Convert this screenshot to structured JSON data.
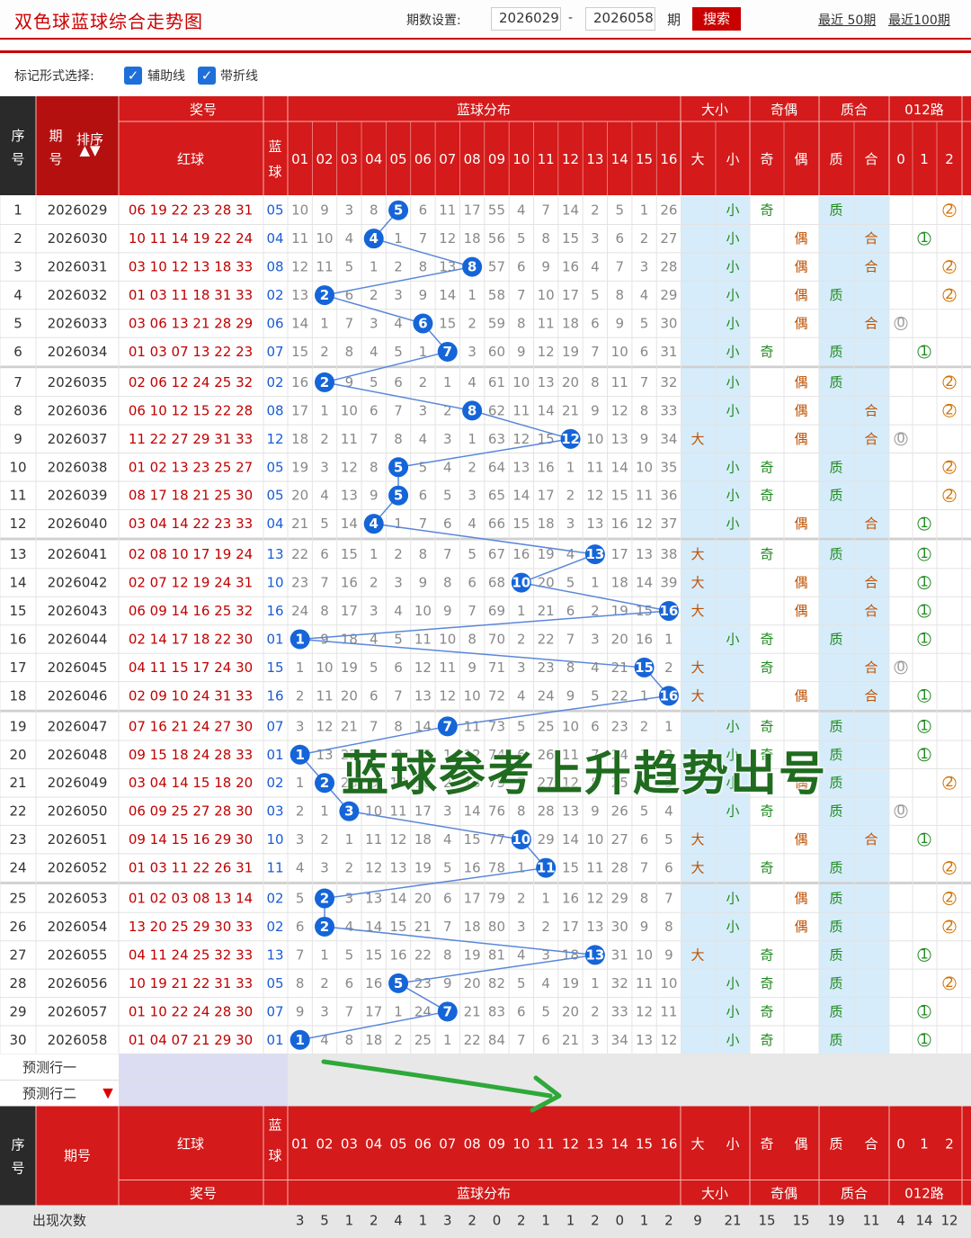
{
  "app": {
    "title": "双色球蓝球综合走势图"
  },
  "toolbar": {
    "issue_label": "期数设置:",
    "start_issue": "2026029",
    "dash": "-",
    "end_issue": "2026058",
    "unit": "期",
    "search_label": "搜索",
    "recent_50": "最近 50期",
    "recent_100": "最近100期"
  },
  "options": {
    "label": "标记形式选择:",
    "aux_line": {
      "label": "辅助线",
      "checked": true
    },
    "fold_line": {
      "label": "带折线",
      "checked": true
    }
  },
  "header": {
    "seq": "序号",
    "period": "期号",
    "sort": "排序",
    "award": "奖号",
    "red": "红球",
    "blue": "蓝球",
    "dist": "蓝球分布",
    "size": "大小",
    "big": "大",
    "small": "小",
    "parity": "奇偶",
    "odd": "奇",
    "even": "偶",
    "prime": "质合",
    "zhi": "质",
    "he": "合",
    "route": "012路",
    "r0": "0",
    "r1": "1",
    "r2": "2",
    "nums": [
      "01",
      "02",
      "03",
      "04",
      "05",
      "06",
      "07",
      "08",
      "09",
      "10",
      "11",
      "12",
      "13",
      "14",
      "15",
      "16"
    ]
  },
  "rows": [
    {
      "seq": "1",
      "period": "2026029",
      "red": "06 19 22 23 28 31",
      "blue": "05",
      "miss": [
        "10",
        "9",
        "3",
        "8",
        "5",
        "6",
        "11",
        "17",
        "55",
        "4",
        "7",
        "14",
        "2",
        "5",
        "1",
        "26"
      ],
      "size": "小",
      "parity": "奇",
      "prime": "质",
      "route": "2"
    },
    {
      "seq": "2",
      "period": "2026030",
      "red": "10 11 14 19 22 24",
      "blue": "04",
      "miss": [
        "11",
        "10",
        "4",
        "4",
        "1",
        "7",
        "12",
        "18",
        "56",
        "5",
        "8",
        "15",
        "3",
        "6",
        "2",
        "27"
      ],
      "size": "小",
      "parity": "偶",
      "prime": "合",
      "route": "1"
    },
    {
      "seq": "3",
      "period": "2026031",
      "red": "03 10 12 13 18 33",
      "blue": "08",
      "miss": [
        "12",
        "11",
        "5",
        "1",
        "2",
        "8",
        "13",
        "8",
        "57",
        "6",
        "9",
        "16",
        "4",
        "7",
        "3",
        "28"
      ],
      "size": "小",
      "parity": "偶",
      "prime": "合",
      "route": "2"
    },
    {
      "seq": "4",
      "period": "2026032",
      "red": "01 03 11 18 31 33",
      "blue": "02",
      "miss": [
        "13",
        "2",
        "6",
        "2",
        "3",
        "9",
        "14",
        "1",
        "58",
        "7",
        "10",
        "17",
        "5",
        "8",
        "4",
        "29"
      ],
      "size": "小",
      "parity": "偶",
      "prime": "质",
      "route": "2"
    },
    {
      "seq": "5",
      "period": "2026033",
      "red": "03 06 13 21 28 29",
      "blue": "06",
      "miss": [
        "14",
        "1",
        "7",
        "3",
        "4",
        "6",
        "15",
        "2",
        "59",
        "8",
        "11",
        "18",
        "6",
        "9",
        "5",
        "30"
      ],
      "size": "小",
      "parity": "偶",
      "prime": "合",
      "route": "0"
    },
    {
      "seq": "6",
      "period": "2026034",
      "red": "01 03 07 13 22 23",
      "blue": "07",
      "miss": [
        "15",
        "2",
        "8",
        "4",
        "5",
        "1",
        "7",
        "3",
        "60",
        "9",
        "12",
        "19",
        "7",
        "10",
        "6",
        "31"
      ],
      "size": "小",
      "parity": "奇",
      "prime": "质",
      "route": "1"
    },
    {
      "seq": "7",
      "period": "2026035",
      "red": "02 06 12 24 25 32",
      "blue": "02",
      "miss": [
        "16",
        "2",
        "9",
        "5",
        "6",
        "2",
        "1",
        "4",
        "61",
        "10",
        "13",
        "20",
        "8",
        "11",
        "7",
        "32"
      ],
      "size": "小",
      "parity": "偶",
      "prime": "质",
      "route": "2"
    },
    {
      "seq": "8",
      "period": "2026036",
      "red": "06 10 12 15 22 28",
      "blue": "08",
      "miss": [
        "17",
        "1",
        "10",
        "6",
        "7",
        "3",
        "2",
        "8",
        "62",
        "11",
        "14",
        "21",
        "9",
        "12",
        "8",
        "33"
      ],
      "size": "小",
      "parity": "偶",
      "prime": "合",
      "route": "2"
    },
    {
      "seq": "9",
      "period": "2026037",
      "red": "11 22 27 29 31 33",
      "blue": "12",
      "miss": [
        "18",
        "2",
        "11",
        "7",
        "8",
        "4",
        "3",
        "1",
        "63",
        "12",
        "15",
        "12",
        "10",
        "13",
        "9",
        "34"
      ],
      "size": "大",
      "parity": "偶",
      "prime": "合",
      "route": "0"
    },
    {
      "seq": "10",
      "period": "2026038",
      "red": "01 02 13 23 25 27",
      "blue": "05",
      "miss": [
        "19",
        "3",
        "12",
        "8",
        "5",
        "5",
        "4",
        "2",
        "64",
        "13",
        "16",
        "1",
        "11",
        "14",
        "10",
        "35"
      ],
      "size": "小",
      "parity": "奇",
      "prime": "质",
      "route": "2"
    },
    {
      "seq": "11",
      "period": "2026039",
      "red": "08 17 18 21 25 30",
      "blue": "05",
      "miss": [
        "20",
        "4",
        "13",
        "9",
        "5",
        "6",
        "5",
        "3",
        "65",
        "14",
        "17",
        "2",
        "12",
        "15",
        "11",
        "36"
      ],
      "size": "小",
      "parity": "奇",
      "prime": "质",
      "route": "2"
    },
    {
      "seq": "12",
      "period": "2026040",
      "red": "03 04 14 22 23 33",
      "blue": "04",
      "miss": [
        "21",
        "5",
        "14",
        "4",
        "1",
        "7",
        "6",
        "4",
        "66",
        "15",
        "18",
        "3",
        "13",
        "16",
        "12",
        "37"
      ],
      "size": "小",
      "parity": "偶",
      "prime": "合",
      "route": "1"
    },
    {
      "seq": "13",
      "period": "2026041",
      "red": "02 08 10 17 19 24",
      "blue": "13",
      "miss": [
        "22",
        "6",
        "15",
        "1",
        "2",
        "8",
        "7",
        "5",
        "67",
        "16",
        "19",
        "4",
        "13",
        "17",
        "13",
        "38"
      ],
      "size": "大",
      "parity": "奇",
      "prime": "质",
      "route": "1"
    },
    {
      "seq": "14",
      "period": "2026042",
      "red": "02 07 12 19 24 31",
      "blue": "10",
      "miss": [
        "23",
        "7",
        "16",
        "2",
        "3",
        "9",
        "8",
        "6",
        "68",
        "10",
        "20",
        "5",
        "1",
        "18",
        "14",
        "39"
      ],
      "size": "大",
      "parity": "偶",
      "prime": "合",
      "route": "1"
    },
    {
      "seq": "15",
      "period": "2026043",
      "red": "06 09 14 16 25 32",
      "blue": "16",
      "miss": [
        "24",
        "8",
        "17",
        "3",
        "4",
        "10",
        "9",
        "7",
        "69",
        "1",
        "21",
        "6",
        "2",
        "19",
        "15",
        "16"
      ],
      "size": "大",
      "parity": "偶",
      "prime": "合",
      "route": "1"
    },
    {
      "seq": "16",
      "period": "2026044",
      "red": "02 14 17 18 22 30",
      "blue": "01",
      "miss": [
        "1",
        "9",
        "18",
        "4",
        "5",
        "11",
        "10",
        "8",
        "70",
        "2",
        "22",
        "7",
        "3",
        "20",
        "16",
        "1"
      ],
      "size": "小",
      "parity": "奇",
      "prime": "质",
      "route": "1"
    },
    {
      "seq": "17",
      "period": "2026045",
      "red": "04 11 15 17 24 30",
      "blue": "15",
      "miss": [
        "1",
        "10",
        "19",
        "5",
        "6",
        "12",
        "11",
        "9",
        "71",
        "3",
        "23",
        "8",
        "4",
        "21",
        "15",
        "2"
      ],
      "size": "大",
      "parity": "奇",
      "prime": "合",
      "route": "0"
    },
    {
      "seq": "18",
      "period": "2026046",
      "red": "02 09 10 24 31 33",
      "blue": "16",
      "miss": [
        "2",
        "11",
        "20",
        "6",
        "7",
        "13",
        "12",
        "10",
        "72",
        "4",
        "24",
        "9",
        "5",
        "22",
        "1",
        "16"
      ],
      "size": "大",
      "parity": "偶",
      "prime": "合",
      "route": "1"
    },
    {
      "seq": "19",
      "period": "2026047",
      "red": "07 16 21 24 27 30",
      "blue": "07",
      "miss": [
        "3",
        "12",
        "21",
        "7",
        "8",
        "14",
        "7",
        "11",
        "73",
        "5",
        "25",
        "10",
        "6",
        "23",
        "2",
        "1"
      ],
      "size": "小",
      "parity": "奇",
      "prime": "质",
      "route": "1"
    },
    {
      "seq": "20",
      "period": "2026048",
      "red": "09 15 18 24 28 33",
      "blue": "01",
      "miss": [
        "1",
        "13",
        "22",
        "8",
        "9",
        "15",
        "1",
        "12",
        "74",
        "6",
        "26",
        "11",
        "7",
        "24",
        "3",
        "2"
      ],
      "size": "小",
      "parity": "奇",
      "prime": "质",
      "route": "1"
    },
    {
      "seq": "21",
      "period": "2026049",
      "red": "03 04 14 15 18 20",
      "blue": "02",
      "miss": [
        "1",
        "2",
        "23",
        "9",
        "10",
        "16",
        "2",
        "13",
        "75",
        "7",
        "27",
        "12",
        "8",
        "25",
        "4",
        "3"
      ],
      "size": "小",
      "parity": "偶",
      "prime": "质",
      "route": "2"
    },
    {
      "seq": "22",
      "period": "2026050",
      "red": "06 09 25 27 28 30",
      "blue": "03",
      "miss": [
        "2",
        "1",
        "3",
        "10",
        "11",
        "17",
        "3",
        "14",
        "76",
        "8",
        "28",
        "13",
        "9",
        "26",
        "5",
        "4"
      ],
      "size": "小",
      "parity": "奇",
      "prime": "质",
      "route": "0"
    },
    {
      "seq": "23",
      "period": "2026051",
      "red": "09 14 15 16 29 30",
      "blue": "10",
      "miss": [
        "3",
        "2",
        "1",
        "11",
        "12",
        "18",
        "4",
        "15",
        "77",
        "10",
        "29",
        "14",
        "10",
        "27",
        "6",
        "5"
      ],
      "size": "大",
      "parity": "偶",
      "prime": "合",
      "route": "1"
    },
    {
      "seq": "24",
      "period": "2026052",
      "red": "01 03 11 22 26 31",
      "blue": "11",
      "miss": [
        "4",
        "3",
        "2",
        "12",
        "13",
        "19",
        "5",
        "16",
        "78",
        "1",
        "11",
        "15",
        "11",
        "28",
        "7",
        "6"
      ],
      "size": "大",
      "parity": "奇",
      "prime": "质",
      "route": "2"
    },
    {
      "seq": "25",
      "period": "2026053",
      "red": "01 02 03 08 13 14",
      "blue": "02",
      "miss": [
        "5",
        "2",
        "3",
        "13",
        "14",
        "20",
        "6",
        "17",
        "79",
        "2",
        "1",
        "16",
        "12",
        "29",
        "8",
        "7"
      ],
      "size": "小",
      "parity": "偶",
      "prime": "质",
      "route": "2"
    },
    {
      "seq": "26",
      "period": "2026054",
      "red": "13 20 25 29 30 33",
      "blue": "02",
      "miss": [
        "6",
        "2",
        "4",
        "14",
        "15",
        "21",
        "7",
        "18",
        "80",
        "3",
        "2",
        "17",
        "13",
        "30",
        "9",
        "8"
      ],
      "size": "小",
      "parity": "偶",
      "prime": "质",
      "route": "2"
    },
    {
      "seq": "27",
      "period": "2026055",
      "red": "04 11 24 25 32 33",
      "blue": "13",
      "miss": [
        "7",
        "1",
        "5",
        "15",
        "16",
        "22",
        "8",
        "19",
        "81",
        "4",
        "3",
        "18",
        "13",
        "31",
        "10",
        "9"
      ],
      "size": "大",
      "parity": "奇",
      "prime": "质",
      "route": "1"
    },
    {
      "seq": "28",
      "period": "2026056",
      "red": "10 19 21 22 31 33",
      "blue": "05",
      "miss": [
        "8",
        "2",
        "6",
        "16",
        "5",
        "23",
        "9",
        "20",
        "82",
        "5",
        "4",
        "19",
        "1",
        "32",
        "11",
        "10"
      ],
      "size": "小",
      "parity": "奇",
      "prime": "质",
      "route": "2"
    },
    {
      "seq": "29",
      "period": "2026057",
      "red": "01 10 22 24 28 30",
      "blue": "07",
      "miss": [
        "9",
        "3",
        "7",
        "17",
        "1",
        "24",
        "7",
        "21",
        "83",
        "6",
        "5",
        "20",
        "2",
        "33",
        "12",
        "11"
      ],
      "size": "小",
      "parity": "奇",
      "prime": "质",
      "route": "1"
    },
    {
      "seq": "30",
      "period": "2026058",
      "red": "01 04 07 21 29 30",
      "blue": "01",
      "miss": [
        "1",
        "4",
        "8",
        "18",
        "2",
        "25",
        "1",
        "22",
        "84",
        "7",
        "6",
        "21",
        "3",
        "34",
        "13",
        "12"
      ],
      "size": "小",
      "parity": "奇",
      "prime": "质",
      "route": "1"
    }
  ],
  "predict": [
    "预测行一",
    "预测行二"
  ],
  "footer": {
    "count_label": "出现次数",
    "counts": [
      "3",
      "5",
      "1",
      "2",
      "4",
      "1",
      "3",
      "2",
      "0",
      "2",
      "1",
      "1",
      "2",
      "0",
      "1",
      "2",
      "9",
      "21",
      "15",
      "15",
      "19",
      "11",
      "4",
      "14",
      "12"
    ]
  },
  "overlay": {
    "text": "蓝球参考上升趋势出号"
  },
  "colors": {
    "header_red": "#d41a1a",
    "ball_blue": "#1565d8",
    "red_text": "#c00000",
    "blue_text": "#1a5cd6",
    "light_blue": "#d6ecfa",
    "green": "#1f6b1f"
  }
}
